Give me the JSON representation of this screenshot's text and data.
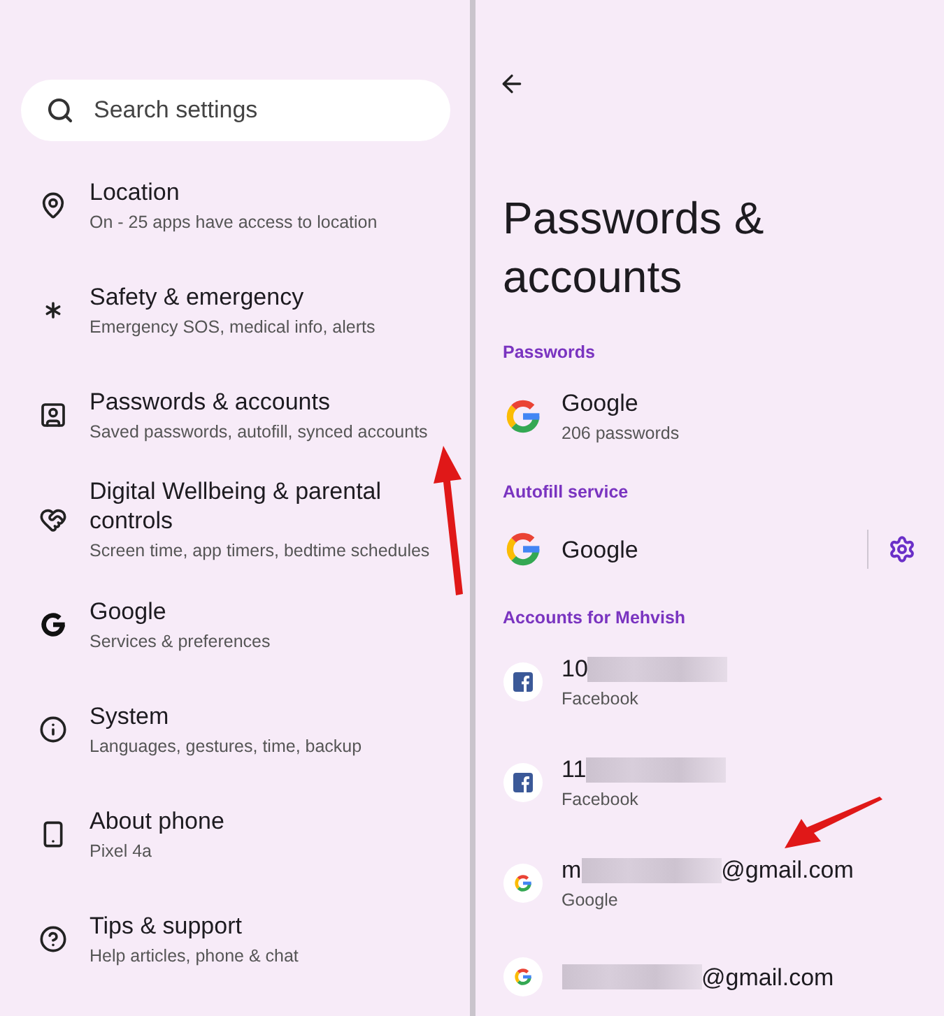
{
  "settings": {
    "search": {
      "placeholder": "Search settings"
    },
    "items": [
      {
        "title": "Location",
        "subtitle": "On - 25 apps have access to location"
      },
      {
        "title": "Safety & emergency",
        "subtitle": "Emergency SOS, medical info, alerts"
      },
      {
        "title": "Passwords & accounts",
        "subtitle": "Saved passwords, autofill, synced accounts"
      },
      {
        "title": "Digital Wellbeing & parental controls",
        "subtitle": "Screen time, app timers, bedtime schedules"
      },
      {
        "title": "Google",
        "subtitle": "Services & preferences"
      },
      {
        "title": "System",
        "subtitle": "Languages, gestures, time, backup"
      },
      {
        "title": "About phone",
        "subtitle": "Pixel 4a"
      },
      {
        "title": "Tips & support",
        "subtitle": "Help articles, phone & chat"
      }
    ]
  },
  "detail": {
    "title": "Passwords & accounts",
    "sections": [
      {
        "header": "Passwords",
        "rows": [
          {
            "kind": "google",
            "title": "Google",
            "subtitle": "206 passwords"
          }
        ]
      },
      {
        "header": "Autofill service",
        "rows": [
          {
            "kind": "google",
            "title": "Google",
            "settings": true
          }
        ]
      },
      {
        "header": "Accounts for Mehvish",
        "rows": [
          {
            "kind": "facebook",
            "title_start": "10",
            "redacted": true,
            "subtitle": "Facebook"
          },
          {
            "kind": "facebook",
            "title_start": "11",
            "redacted": true,
            "subtitle": "Facebook"
          },
          {
            "kind": "google-small",
            "title_start": "m",
            "redacted": true,
            "title_end": "@gmail.com",
            "subtitle": "Google"
          },
          {
            "kind": "google-small",
            "redacted": true,
            "title_end": "@gmail.com"
          }
        ]
      }
    ]
  }
}
